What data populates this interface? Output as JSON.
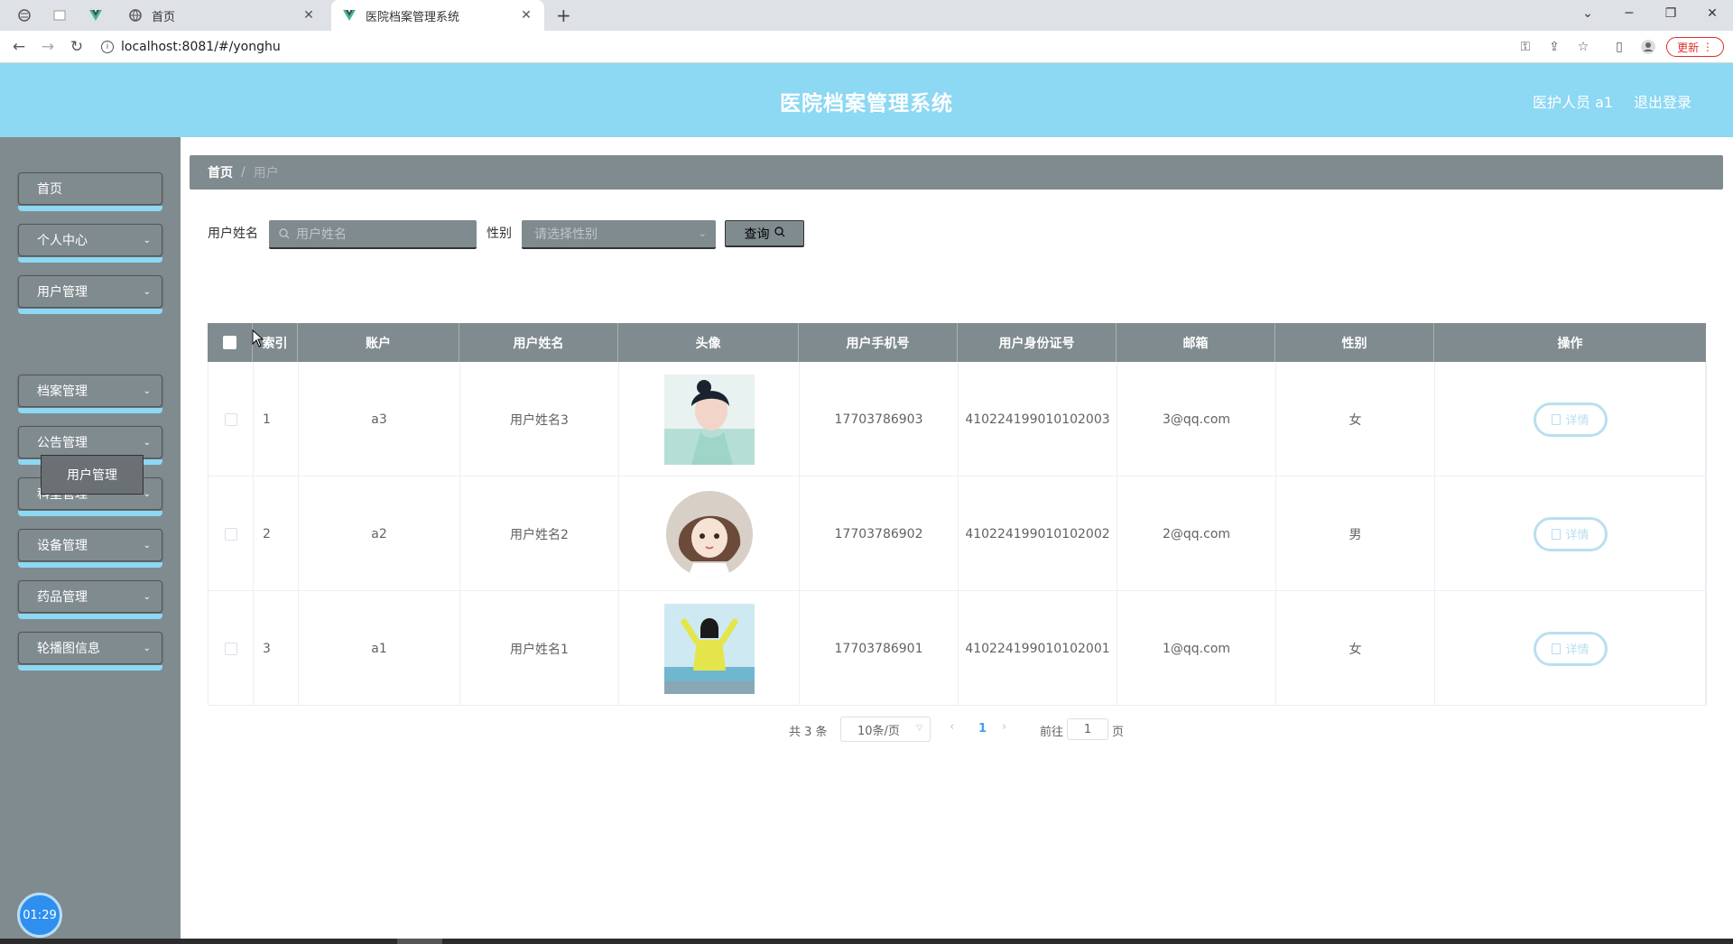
{
  "browser": {
    "tabs": [
      {
        "title": "首页"
      },
      {
        "title": "医院档案管理系统"
      }
    ],
    "url": "localhost:8081/#/yonghu",
    "update_label": "更新"
  },
  "header": {
    "title": "医院档案管理系统",
    "user": "医护人员 a1",
    "logout": "退出登录"
  },
  "sidebar": {
    "items": [
      {
        "label": "首页",
        "has_arrow": false
      },
      {
        "label": "个人中心",
        "has_arrow": true
      },
      {
        "label": "用户管理",
        "has_arrow": true
      },
      {
        "label": "档案管理",
        "has_arrow": true
      },
      {
        "label": "公告管理",
        "has_arrow": true
      },
      {
        "label": "科室管理",
        "has_arrow": true
      },
      {
        "label": "设备管理",
        "has_arrow": true
      },
      {
        "label": "药品管理",
        "has_arrow": true
      },
      {
        "label": "轮播图信息",
        "has_arrow": true
      }
    ],
    "submenu_label": "用户管理",
    "timer": "01:29"
  },
  "breadcrumb": {
    "home": "首页",
    "sep": "/",
    "current": "用户"
  },
  "search": {
    "name_label": "用户姓名",
    "name_placeholder": "用户姓名",
    "gender_label": "性别",
    "gender_placeholder": "请选择性别",
    "query_label": "查询"
  },
  "table": {
    "headers": [
      "",
      "索引",
      "账户",
      "用户姓名",
      "头像",
      "用户手机号",
      "用户身份证号",
      "邮箱",
      "性别",
      "操作"
    ],
    "rows": [
      {
        "index": "1",
        "account": "a3",
        "name": "用户姓名3",
        "avatar": "woman-blue-avatar",
        "phone": "17703786903",
        "id_card": "410224199010102003",
        "email": "3@qq.com",
        "gender": "女",
        "action": "详情"
      },
      {
        "index": "2",
        "account": "a2",
        "name": "用户姓名2",
        "avatar": "cartoon-girl-avatar",
        "phone": "17703786902",
        "id_card": "410224199010102002",
        "email": "2@qq.com",
        "gender": "男",
        "action": "详情"
      },
      {
        "index": "3",
        "account": "a1",
        "name": "用户姓名1",
        "avatar": "woman-yellow-avatar",
        "phone": "17703786901",
        "id_card": "410224199010102001",
        "email": "1@qq.com",
        "gender": "女",
        "action": "详情"
      }
    ]
  },
  "pagination": {
    "total": "共 3 条",
    "page_size": "10条/页",
    "current": "1",
    "goto_label": "前往",
    "goto_value": "1",
    "page_unit": "页"
  },
  "colors": {
    "header_bg": "#8dd8f3",
    "sidebar_bg": "#808b8f",
    "accent": "#409eff"
  }
}
